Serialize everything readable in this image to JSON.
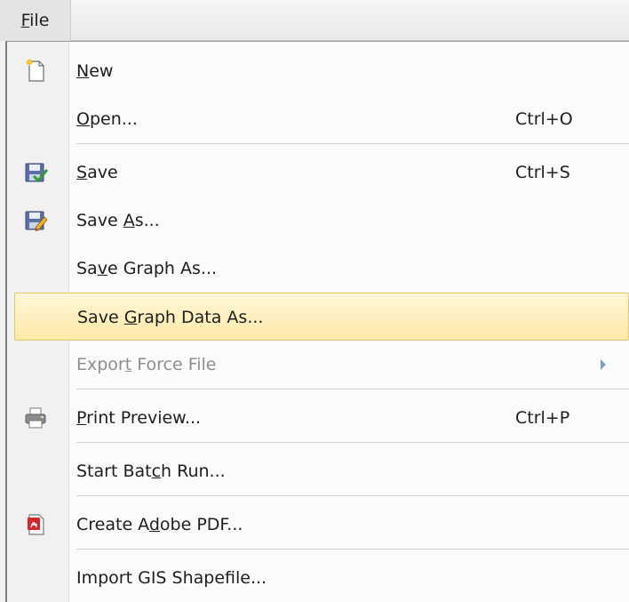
{
  "menubar": {
    "file": {
      "prefix": "",
      "accel": "F",
      "rest": "ile"
    }
  },
  "menu": {
    "new": {
      "pre": "",
      "accel": "N",
      "post": "ew",
      "shortcut": ""
    },
    "open": {
      "pre": "",
      "accel": "O",
      "post": "pen...",
      "shortcut": "Ctrl+O"
    },
    "save": {
      "pre": "",
      "accel": "S",
      "post": "ave",
      "shortcut": "Ctrl+S"
    },
    "save_as": {
      "pre": "Save ",
      "accel": "A",
      "post": "s...",
      "shortcut": ""
    },
    "save_graph_as": {
      "pre": "Sa",
      "accel": "v",
      "post": "e Graph As...",
      "shortcut": ""
    },
    "save_graph_data_as": {
      "pre": "Save ",
      "accel": "G",
      "post": "raph Data As...",
      "shortcut": ""
    },
    "export_force_file": {
      "pre": "Expor",
      "accel": "t",
      "post": " Force File",
      "shortcut": ""
    },
    "print_preview": {
      "pre": "",
      "accel": "P",
      "post": "rint Preview...",
      "shortcut": "Ctrl+P"
    },
    "start_batch_run": {
      "pre": "Start Bat",
      "accel": "c",
      "post": "h Run...",
      "shortcut": ""
    },
    "create_adobe_pdf": {
      "pre": "Create A",
      "accel": "d",
      "post": "obe PDF...",
      "shortcut": ""
    },
    "import_gis_shapefile": {
      "pre": "Import GIS Shapefile...",
      "accel": "",
      "post": "",
      "shortcut": ""
    }
  },
  "icons": {
    "new": "new-document-icon",
    "save": "save-check-icon",
    "save_as": "save-as-icon",
    "print": "printer-icon",
    "pdf": "adobe-pdf-icon",
    "submenu": "submenu-arrow-icon"
  },
  "colors": {
    "highlight_top": "#fff7d9",
    "highlight_bottom": "#ffe9a8",
    "highlight_border": "#e7c36a",
    "disabled_text": "#8e8e8e"
  }
}
